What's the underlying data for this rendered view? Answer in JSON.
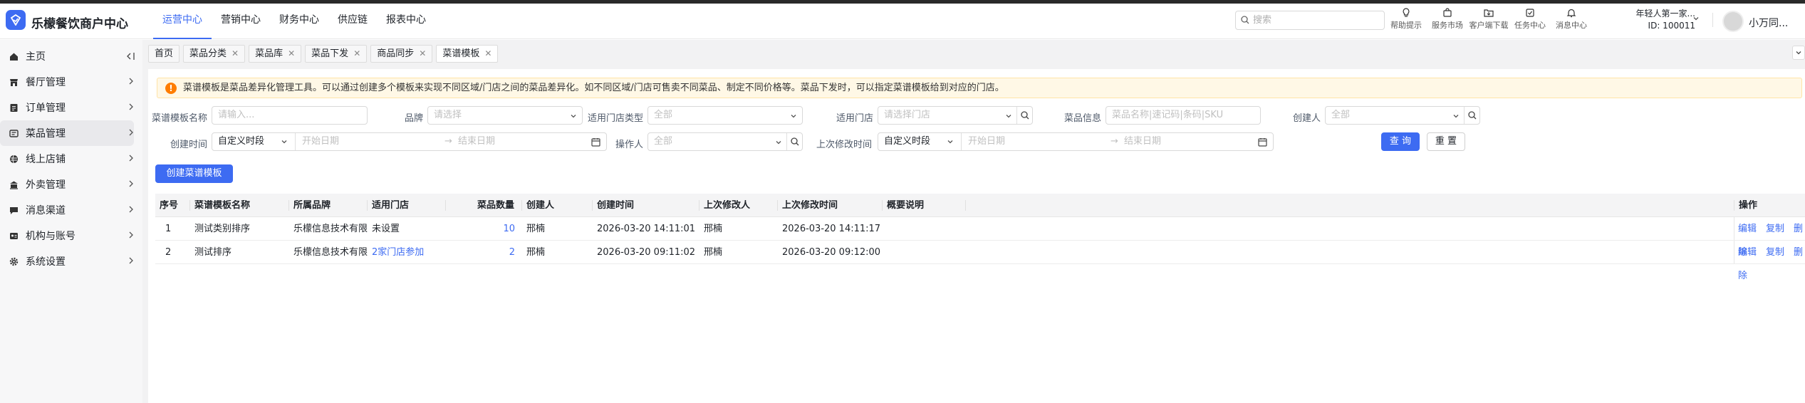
{
  "app": {
    "name": "乐檬餐饮商户中心",
    "accent": "#3d6bf2"
  },
  "topnav": [
    {
      "label": "运营中心",
      "active": true
    },
    {
      "label": "营销中心"
    },
    {
      "label": "财务中心"
    },
    {
      "label": "供应链"
    },
    {
      "label": "报表中心"
    }
  ],
  "search": {
    "placeholder": "搜索"
  },
  "tools": [
    {
      "label": "帮助提示",
      "icon": "lightbulb-icon"
    },
    {
      "label": "服务市场",
      "icon": "shopping-bag-icon"
    },
    {
      "label": "客户端下载",
      "icon": "download-folder-icon"
    },
    {
      "label": "任务中心",
      "icon": "task-icon"
    },
    {
      "label": "消息中心",
      "icon": "bell-icon"
    }
  ],
  "account": {
    "store": "年轻人第一家...",
    "id": "ID: 100011",
    "username": "小万同..."
  },
  "sidebar": {
    "items": [
      {
        "label": "主页",
        "icon": "home-icon"
      },
      {
        "label": "餐厅管理",
        "icon": "store-icon"
      },
      {
        "label": "订单管理",
        "icon": "order-icon"
      },
      {
        "label": "菜品管理",
        "icon": "dish-icon",
        "active": true
      },
      {
        "label": "线上店铺",
        "icon": "globe-icon"
      },
      {
        "label": "外卖管理",
        "icon": "delivery-icon"
      },
      {
        "label": "消息渠道",
        "icon": "chat-icon"
      },
      {
        "label": "机构与账号",
        "icon": "org-icon"
      },
      {
        "label": "系统设置",
        "icon": "gear-icon"
      }
    ]
  },
  "tabs": [
    {
      "label": "首页",
      "closable": false
    },
    {
      "label": "菜品分类",
      "closable": true
    },
    {
      "label": "菜品库",
      "closable": true
    },
    {
      "label": "菜品下发",
      "closable": true
    },
    {
      "label": "商品同步",
      "closable": true
    },
    {
      "label": "菜谱模板",
      "closable": true,
      "active": true
    }
  ],
  "notice": "菜谱模板是菜品差异化管理工具。可以通过创建多个模板来实现不同区域/门店之间的菜品差异化。如不同区域/门店可售卖不同菜品、制定不同价格等。菜品下发时，可以指定菜谱模板给到对应的门店。",
  "filters": {
    "template_name": {
      "label": "菜谱模板名称",
      "placeholder": "请输入..."
    },
    "brand": {
      "label": "品牌",
      "placeholder": "请选择"
    },
    "store_type": {
      "label": "适用门店类型",
      "placeholder": "全部"
    },
    "store": {
      "label": "适用门店",
      "placeholder": "请选择门店"
    },
    "dish_info": {
      "label": "菜品信息",
      "placeholder": "菜品名称|速记码|条码|SKU"
    },
    "creator": {
      "label": "创建人",
      "placeholder": "全部"
    },
    "create_time": {
      "label": "创建时间",
      "mode": "自定义时段",
      "start": "开始日期",
      "end": "结束日期"
    },
    "operator": {
      "label": "操作人",
      "placeholder": "全部"
    },
    "modify_time": {
      "label": "上次修改时间",
      "mode": "自定义时段",
      "start": "开始日期",
      "end": "结束日期"
    },
    "query_button": "查 询",
    "reset_button": "重 置"
  },
  "create_button": "创建菜谱模板",
  "table": {
    "columns": [
      "序号",
      "菜谱模板名称",
      "所属品牌",
      "适用门店",
      "菜品数量",
      "创建人",
      "创建时间",
      "上次修改人",
      "上次修改时间",
      "概要说明",
      "操作"
    ],
    "rows": [
      {
        "no": "1",
        "name": "测试类别排序",
        "brand": "乐檬信息技术有限",
        "stores": "未设置",
        "count": "10",
        "creator": "邢楠",
        "created": "2026-03-20 14:11:01",
        "modifier": "邢楠",
        "modified": "2026-03-20 14:11:17",
        "summary": ""
      },
      {
        "no": "2",
        "name": "测试排序",
        "brand": "乐檬信息技术有限",
        "stores": "2家门店参加",
        "count": "2",
        "creator": "邢楠",
        "created": "2026-03-20 09:11:02",
        "modifier": "邢楠",
        "modified": "2026-03-20 09:12:00",
        "summary": ""
      }
    ],
    "actions": [
      "编辑",
      "复制",
      "删除"
    ]
  }
}
